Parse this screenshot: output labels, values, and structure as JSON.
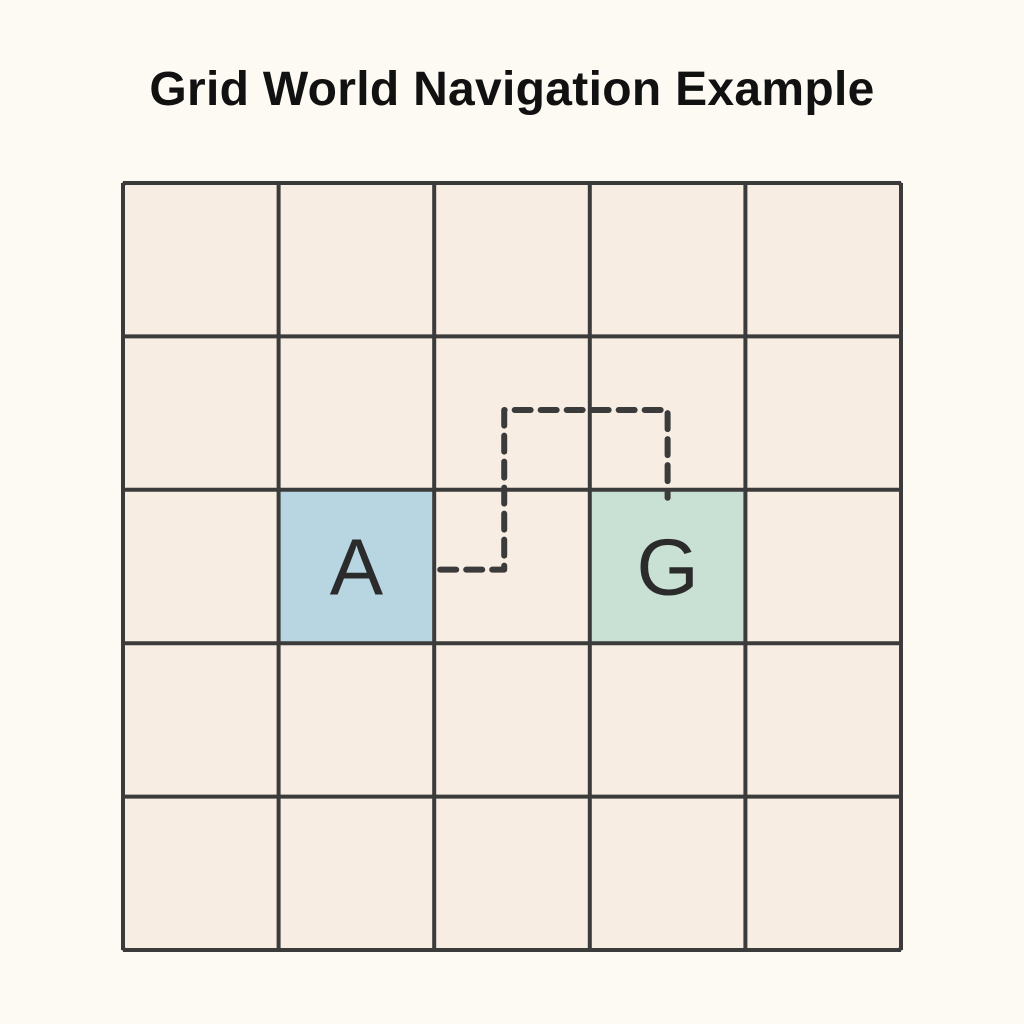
{
  "title": "Grid World Navigation Example",
  "grid": {
    "rows": 5,
    "cols": 5,
    "cell_fill": "#f8ede2",
    "line_color": "#3b3b3b",
    "agent": {
      "label": "A",
      "row": 3,
      "col": 2,
      "fill": "#b7d6e2"
    },
    "goal": {
      "label": "G",
      "row": 3,
      "col": 4,
      "fill": "#c8e1d4"
    },
    "path": {
      "style": "dashed",
      "color": "#3b3b3b",
      "waypoints": [
        {
          "row": 3,
          "col": 2,
          "anchor": "right-edge"
        },
        {
          "row": 3,
          "col": 3,
          "anchor": "center"
        },
        {
          "row": 2,
          "col": 3,
          "anchor": "center"
        },
        {
          "row": 2,
          "col": 4,
          "anchor": "center"
        },
        {
          "row": 3,
          "col": 4,
          "anchor": "top-edge"
        }
      ]
    }
  }
}
